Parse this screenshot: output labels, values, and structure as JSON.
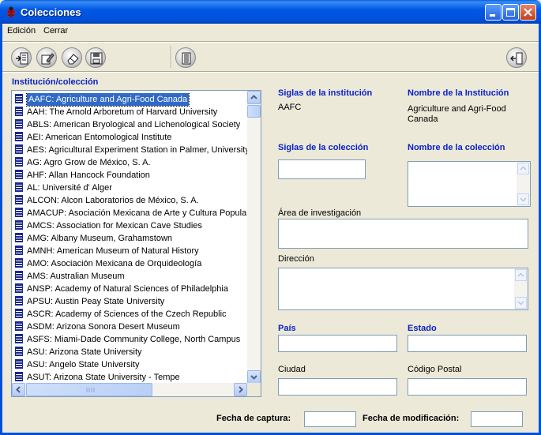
{
  "window": {
    "title": "Colecciones",
    "colors": {
      "titlebar": "#0050d8",
      "accent_label": "#0a22c8",
      "selection": "#316ac5"
    }
  },
  "menu": {
    "items": [
      {
        "label": "Edición"
      },
      {
        "label": "Cerrar"
      }
    ]
  },
  "toolbar": {
    "buttons": [
      {
        "icon": "add-record-icon"
      },
      {
        "icon": "edit-record-icon"
      },
      {
        "icon": "erase-record-icon"
      },
      {
        "icon": "save-icon"
      },
      {
        "icon": "building-icon"
      },
      {
        "icon": "exit-door-icon"
      }
    ]
  },
  "list": {
    "heading": "Institución/colección",
    "selected_index": 0,
    "items": [
      "AAFC:  Agriculture and Agri-Food Canada",
      "AAH:  The Arnold Arboretum of Harvard University",
      "ABLS:  American Bryological and Lichenological Society",
      "AEI:  American Entomological Institute",
      "AES:  Agricultural Experiment Station in Palmer, University o",
      "AG:  Agro Grow de México, S. A.",
      "AHF:  Allan Hancock Foundation",
      "AL:  Université d' Alger",
      "ALCON:  Alcon Laboratorios de México, S. A.",
      "AMACUP:  Asociación Mexicana de Arte y Cultura Popular,",
      "AMCS:  Association for Mexican Cave Studies",
      "AMG:  Albany Museum, Grahamstown",
      "AMNH:  American Museum of Natural History",
      "AMO:  Asociación Mexicana de Orquideología",
      "AMS:  Australian Museum",
      "ANSP:  Academy of Natural Sciences of Philadelphia",
      "APSU:  Austin Peay State University",
      "ASCR:  Academy of Sciences of the Czech Republic",
      "ASDM:  Arizona Sonora Desert Museum",
      "ASFS:  Miami-Dade Community College, North Campus",
      "ASU:  Arizona State University",
      "ASU:  Angelo State University",
      "ASUT:  Arizona State University - Tempe"
    ]
  },
  "detail": {
    "siglas_institucion_label": "Siglas de la institución",
    "siglas_institucion_value": "AAFC",
    "nombre_institucion_label": "Nombre de la Institución",
    "nombre_institucion_value": "Agriculture and Agri-Food Canada",
    "siglas_coleccion_label": "Siglas de la colección",
    "siglas_coleccion_value": "",
    "nombre_coleccion_label": "Nombre de la colección",
    "nombre_coleccion_value": "",
    "area_label": "Área de investigación",
    "area_value": "",
    "direccion_label": "Dirección",
    "direccion_value": "",
    "pais_label": "País",
    "pais_value": "",
    "estado_label": "Estado",
    "estado_value": "",
    "ciudad_label": "Ciudad",
    "ciudad_value": "",
    "cp_label": "Código Postal",
    "cp_value": ""
  },
  "footer": {
    "fecha_captura_label": "Fecha de captura:",
    "fecha_captura_value": "",
    "fecha_modificacion_label": "Fecha de modificación:",
    "fecha_modificacion_value": ""
  }
}
